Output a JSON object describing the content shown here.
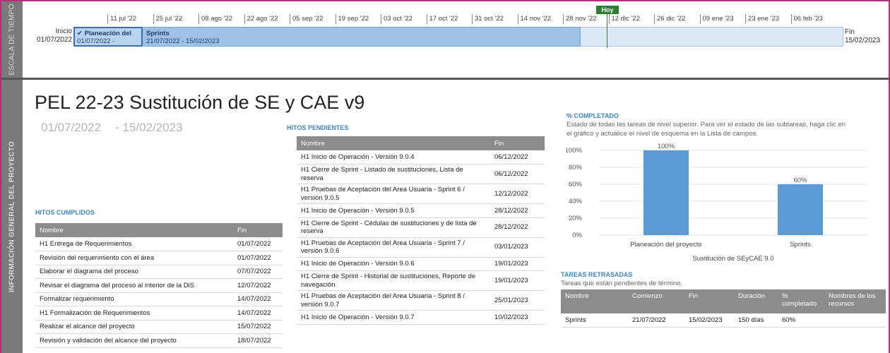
{
  "timeline": {
    "side_label": "ESCALA DE TIEMPO",
    "ticks": [
      "11 jul '22",
      "25 jul '22",
      "08 ago '22",
      "22 ago '22",
      "05 sep '22",
      "19 sep '22",
      "03 oct '22",
      "17 oct '22",
      "31 oct '22",
      "14 nov '22",
      "28 nov '22",
      "12 dic '22",
      "26 dic '22",
      "09 ene '23",
      "23 ene '23",
      "06 feb '23"
    ],
    "start_label": "Inicio",
    "start_date": "01/07/2022",
    "end_label": "Fin",
    "end_date": "15/02/2023",
    "today_label": "Hoy",
    "tasks": [
      {
        "name": "Planeación del",
        "dates": "01/07/2022 -"
      },
      {
        "name": "Sprints",
        "dates": "21/07/2022 - 15/02/2023"
      }
    ],
    "colors": {
      "today": "#2e7d32",
      "bar": "#9ec1e6",
      "frame": "#b3307a"
    }
  },
  "project": {
    "side_label": "INFORMACIÓN GENERAL DEL PROYECTO",
    "title": "PEL 22-23 Sustitución de SE y CAE v9",
    "start": "01/07/2022",
    "end": "- 15/02/2023"
  },
  "hitos_cumplidos": {
    "title": "HITOS CUMPLIDOS",
    "columns": [
      "Nombre",
      "Fin"
    ],
    "rows": [
      [
        "H1 Entrega de Requerimientos",
        "01/07/2022"
      ],
      [
        "Revisión del requerimiento con el área",
        "01/07/2022"
      ],
      [
        "Elaborar el diagrama del proceso",
        "07/07/2022"
      ],
      [
        "Revisar el diagrama del proceso al interior de la DiS",
        "12/07/2022"
      ],
      [
        "Formalizar requerimiento",
        "14/07/2022"
      ],
      [
        "H1 Formalización de Requerimientos",
        "14/07/2022"
      ],
      [
        "Realizar el alcance del proyecto",
        "15/07/2022"
      ],
      [
        "Revisión y validación del alcance del proyecto",
        "18/07/2022"
      ]
    ]
  },
  "hitos_pendientes": {
    "title": "HITOS PENDIENTES",
    "columns": [
      "Nombre",
      "Fin"
    ],
    "rows": [
      [
        "H1 Inicio de Operación - Versión 9.0.4",
        "06/12/2022"
      ],
      [
        "H1 Cierre de Sprint - Listado de sustituciones, Lista de reserva",
        "06/12/2022"
      ],
      [
        "H1 Pruebas de Aceptación del Area Usuaria - Sprint 6 / versión 9.0.5",
        "12/12/2022"
      ],
      [
        "H1 Inicio de Operación - Versión 9.0.5",
        "28/12/2022"
      ],
      [
        "H1 Cierre de Sprint - Cédulas de sustituciones y de lista de reserva",
        "28/12/2022"
      ],
      [
        "H1 Pruebas de Aceptación del Area Usuaria - Sprint 7 / versión 9.0.6",
        "03/01/2023"
      ],
      [
        "H1 Inicio de Operación - Versión 9.0.6",
        "19/01/2023"
      ],
      [
        "H1 Cierre de Sprint - Historial de sustituciones, Reporte de navegación",
        "19/01/2023"
      ],
      [
        "H1 Pruebas de Aceptación del Area Usuaria - Sprint 8 / versión 9.0.7",
        "25/01/2023"
      ],
      [
        "H1 Inicio de Operación - Versión 9.0.7",
        "10/02/2023"
      ]
    ]
  },
  "completado": {
    "title": "% COMPLETADO",
    "description": "Estado de todas las tareas de nivel superior. Para ver el estado de las subtareas, haga clic en el gráfico y actualice el nivel de esquema en la Lista de campos."
  },
  "chart_data": {
    "type": "bar",
    "categories": [
      "Planeación del proyecto",
      "Sprints"
    ],
    "values": [
      100,
      60
    ],
    "data_labels": [
      "100%",
      "60%"
    ],
    "title": "",
    "xlabel": "Sustitución de SEyCAE 9.0",
    "ylabel": "",
    "ylim": [
      0,
      100
    ],
    "yticks": [
      "0%",
      "20%",
      "40%",
      "60%",
      "80%",
      "100%"
    ],
    "grid": true,
    "bar_color": "#5b9bd5"
  },
  "tareas_retrasadas": {
    "title": "TAREAS RETRASADAS",
    "subtitle": "Tareas que están pendientes de término.",
    "columns": [
      "Nombre",
      "Comienzo",
      "Fin",
      "Duración",
      "% completado",
      "Nombres de los recursos"
    ],
    "rows": [
      [
        "Sprints",
        "21/07/2022",
        "15/02/2023",
        "150 días",
        "60%",
        ""
      ]
    ]
  }
}
